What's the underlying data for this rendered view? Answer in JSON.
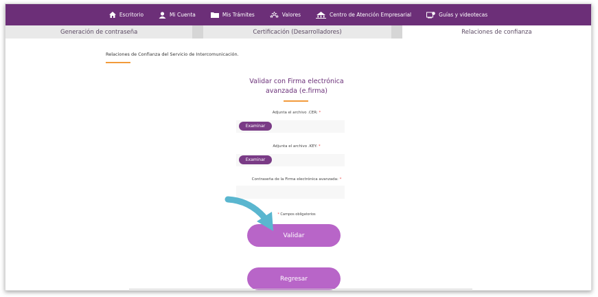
{
  "nav": {
    "items": [
      {
        "label": "Escritorio",
        "icon": "home-icon"
      },
      {
        "label": "Mi Cuenta",
        "icon": "user-icon"
      },
      {
        "label": "Mis Trámites",
        "icon": "folder-icon"
      },
      {
        "label": "Valores",
        "icon": "stars-icon"
      },
      {
        "label": "Centro de Atención Empresarial",
        "icon": "building-icon"
      },
      {
        "label": "Guías y videotecas",
        "icon": "video-icon"
      }
    ]
  },
  "tabs": [
    {
      "label": "Generación de contraseña"
    },
    {
      "label": "Certificación (Desarrolladores)"
    },
    {
      "label": "Relaciones de confianza"
    }
  ],
  "intro": {
    "text": "Relaciones de Confianza del Servicio de Intercomunicación."
  },
  "form": {
    "title": "Validar con Firma electrónica avanzada (e.firma)",
    "cer_label": "Adjunta el archivo .CER:",
    "key_label": "Adjunta el archivo .KEY:",
    "password_label": "Contraseña de la Firma electrónica avanzada:",
    "required_mark": "*",
    "browse_label": "Examinar",
    "required_note": "Campos obligatorios",
    "validate_label": "Validar",
    "back_label": "Regresar"
  },
  "colors": {
    "nav_bg": "#6c2f78",
    "accent": "#f29a3a",
    "button": "#b865c8",
    "arrow": "#5ab6cf"
  }
}
